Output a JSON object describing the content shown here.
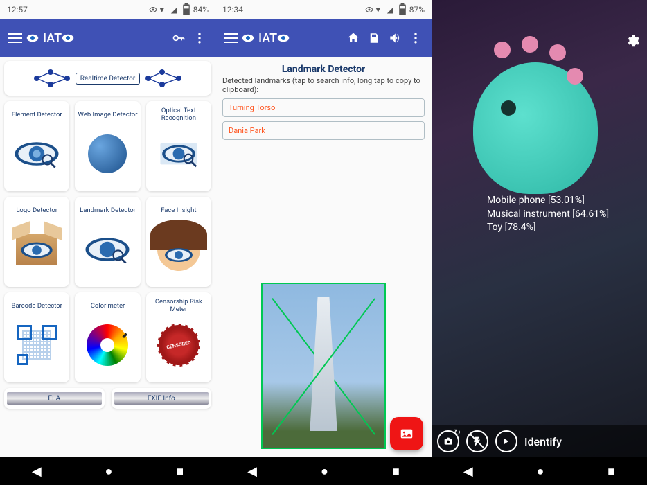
{
  "pane1": {
    "status": {
      "time": "12:57",
      "battery": "84%"
    },
    "appbar": {
      "title": "IAT"
    },
    "realtime_label": "Realtime Detector",
    "cards": [
      {
        "title": "Element Detector"
      },
      {
        "title": "Web Image Detector"
      },
      {
        "title": "Optical Text Recognition"
      },
      {
        "title": "Logo Detector"
      },
      {
        "title": "Landmark Detector"
      },
      {
        "title": "Face Insight"
      },
      {
        "title": "Barcode Detector"
      },
      {
        "title": "Colorimeter"
      },
      {
        "title": "Censorship Risk Meter"
      }
    ],
    "wide": [
      {
        "title": "ELA"
      },
      {
        "title": "EXIF Info"
      }
    ]
  },
  "pane2": {
    "status": {
      "time": "12:34",
      "battery": "87%"
    },
    "appbar": {
      "title": "IAT"
    },
    "landmark": {
      "header": "Landmark Detector",
      "desc": "Detected landmarks (tap to search info, long tap to copy to clipboard):",
      "results": [
        "Turning Torso",
        "Dania Park"
      ]
    }
  },
  "pane3": {
    "detections": [
      "Mobile phone [53.01%]",
      "Musical instrument [64.61%]",
      "Toy [78.4%]"
    ],
    "action_label": "Identify"
  }
}
